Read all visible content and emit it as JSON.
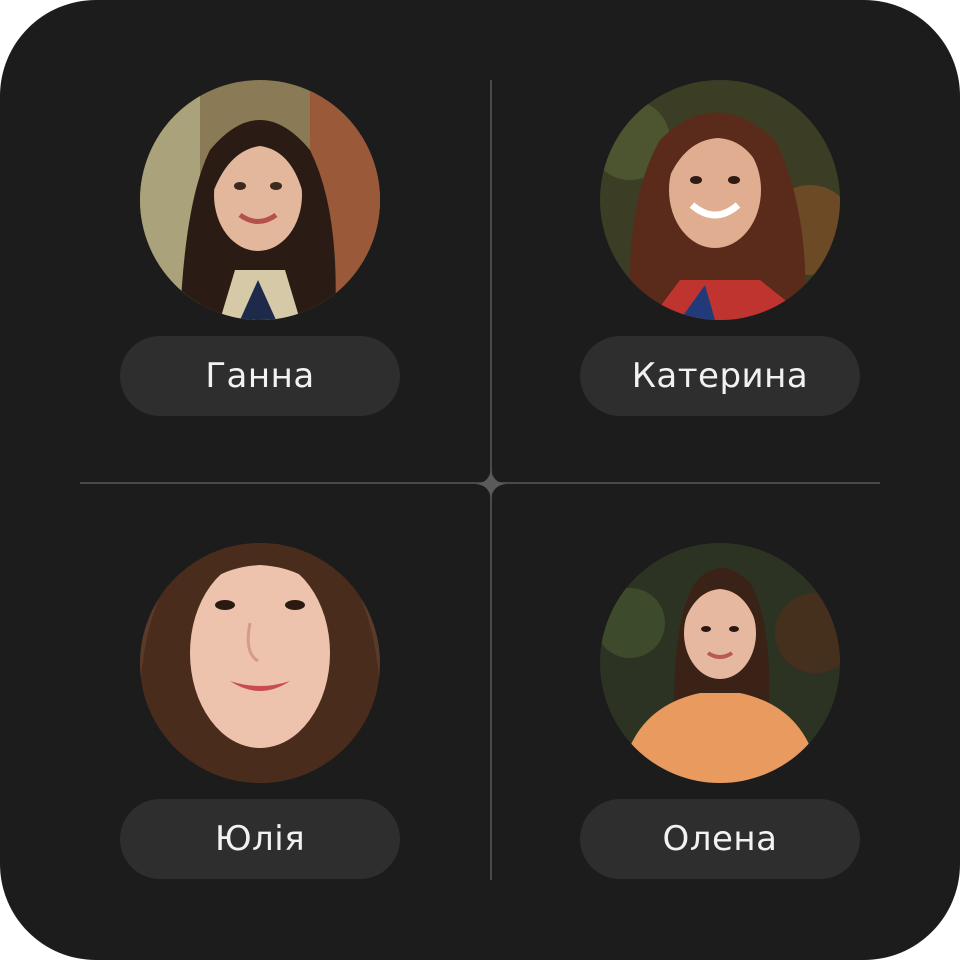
{
  "people": [
    {
      "name": "Ганна"
    },
    {
      "name": "Катерина"
    },
    {
      "name": "Юлія"
    },
    {
      "name": "Олена"
    }
  ],
  "colors": {
    "card_background": "#1c1c1c",
    "pill_background": "#2e2e2e",
    "pill_text": "#f2f2f2",
    "divider": "#4a4a4a"
  }
}
